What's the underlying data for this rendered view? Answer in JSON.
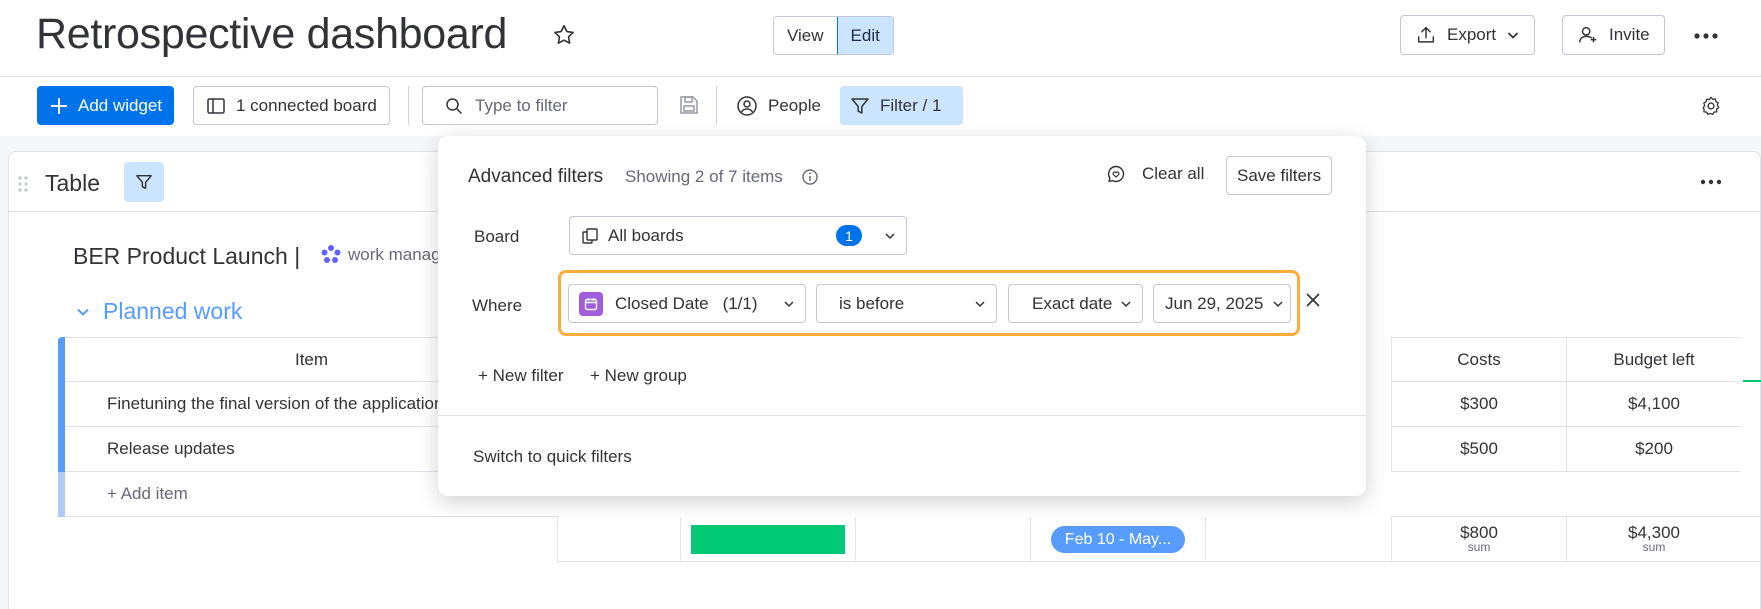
{
  "header": {
    "title": "Retrospective dashboard",
    "view_label": "View",
    "edit_label": "Edit",
    "export_label": "Export",
    "invite_label": "Invite"
  },
  "toolbar": {
    "add_widget_label": "Add widget",
    "connected_board_label": "1 connected board",
    "search_placeholder": "Type to filter",
    "people_label": "People",
    "filter_label": "Filter / 1"
  },
  "widget": {
    "title": "Table",
    "board_name": "BER Product Launch",
    "board_separator": "|",
    "workspace_label": "work management",
    "group_name": "Planned work",
    "columns": {
      "item": "Item",
      "costs": "Costs",
      "budget_left": "Budget left"
    },
    "rows": [
      {
        "item": "Finetuning the final version of the application",
        "costs": "$300",
        "budget_left": "$4,100"
      },
      {
        "item": "Release updates",
        "costs": "$500",
        "budget_left": "$200"
      }
    ],
    "add_item_label": "+ Add item",
    "summary": {
      "timeline": "Feb 10 - May...",
      "costs_sum": "$800",
      "budget_sum": "$4,300",
      "sum_label": "sum"
    },
    "colors": {
      "group": "#579bfc",
      "status_done": "#00c875"
    }
  },
  "filters_popover": {
    "title": "Advanced filters",
    "subtitle": "Showing 2 of 7 items",
    "clear_all_label": "Clear all",
    "save_filters_label": "Save filters",
    "board_label": "Board",
    "board_value": "All boards",
    "board_count": "1",
    "where_label": "Where",
    "column_value": "Closed Date",
    "column_count": "(1/1)",
    "condition_value": "is before",
    "date_type_value": "Exact date",
    "date_value": "Jun 29, 2025",
    "new_filter_label": "+ New filter",
    "new_group_label": "+ New group",
    "switch_label": "Switch to quick filters",
    "highlight_color": "#fdab3d"
  }
}
